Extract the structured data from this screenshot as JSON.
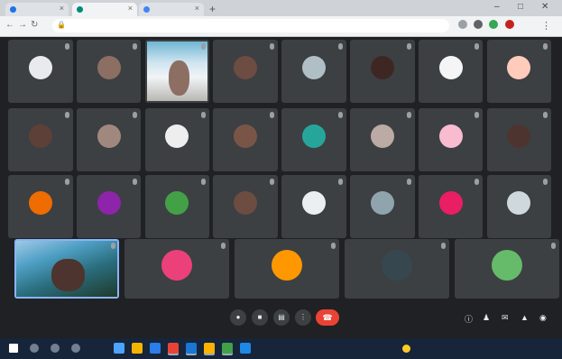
{
  "browser": {
    "tabs": [
      {
        "title": "",
        "active": false,
        "favicon_color": "#1a73e8"
      },
      {
        "title": "",
        "active": true,
        "favicon_color": "#00897b"
      },
      {
        "title": "",
        "active": false,
        "favicon_color": "#4285f4"
      }
    ],
    "new_tab_icon": "plus-icon",
    "url": "",
    "icons": [
      "back-icon",
      "forward-icon",
      "reload-icon",
      "lock-icon",
      "star-icon",
      "extension-icon",
      "profile-icon",
      "menu-icon"
    ]
  },
  "participants": [
    {
      "name": "",
      "avatar_color": "#e8eaed"
    },
    {
      "name": "",
      "avatar_color": "#8d6e63"
    },
    {
      "name": "",
      "avatar_color": "#d7ccc8",
      "video": true
    },
    {
      "name": "",
      "avatar_color": "#6d4c41"
    },
    {
      "name": "",
      "avatar_color": "#b0bec5"
    },
    {
      "name": "",
      "avatar_color": "#3e2723"
    },
    {
      "name": "",
      "avatar_color": "#f5f5f5"
    },
    {
      "name": "",
      "avatar_color": "#ffccbc"
    },
    {
      "name": "",
      "avatar_color": "#5d4037"
    },
    {
      "name": "",
      "avatar_color": "#a1887f"
    },
    {
      "name": "",
      "avatar_color": "#eeeeee"
    },
    {
      "name": "",
      "avatar_color": "#795548"
    },
    {
      "name": "",
      "avatar_color": "#26a69a"
    },
    {
      "name": "",
      "avatar_color": "#bcaaa4"
    },
    {
      "name": "",
      "avatar_color": "#f8bbd0"
    },
    {
      "name": "",
      "avatar_color": "#4e342e"
    },
    {
      "name": "",
      "avatar_color": "#ef6c00"
    },
    {
      "name": "",
      "avatar_color": "#8e24aa"
    },
    {
      "name": "",
      "avatar_color": "#43a047"
    },
    {
      "name": "",
      "avatar_color": "#6d4c41"
    },
    {
      "name": "",
      "avatar_color": "#eceff1"
    },
    {
      "name": "",
      "avatar_color": "#90a4ae"
    },
    {
      "name": "",
      "avatar_color": "#e91e63"
    },
    {
      "name": "",
      "avatar_color": "#cfd8dc"
    },
    {
      "name": "",
      "avatar_color": "#e0f2f1",
      "video": true,
      "speaking": true
    },
    {
      "name": "",
      "avatar_color": "#ec407a"
    },
    {
      "name": "",
      "avatar_color": "#ff9800"
    },
    {
      "name": "",
      "avatar_color": "#37474f"
    },
    {
      "name": "",
      "avatar_color": "#66bb6a"
    }
  ],
  "controls": {
    "meeting_info": "",
    "buttons": [
      "mic-icon",
      "camera-icon",
      "captions-icon",
      "more-icon"
    ],
    "leave_icon": "hang-up-icon",
    "right_icons": [
      "info-icon",
      "people-icon",
      "chat-icon",
      "activities-icon",
      "lock-icon"
    ]
  },
  "taskbar": {
    "apps": [
      {
        "color": "#ffffff",
        "icon": "windows-icon"
      },
      {
        "color": "#9aa7b8",
        "icon": "search-icon"
      },
      {
        "color": "#9aa7b8",
        "icon": "task-view-icon"
      },
      {
        "color": "#9aa7b8",
        "icon": "widgets-icon"
      },
      {
        "color": "#4da3ff",
        "icon": "edge-icon"
      },
      {
        "color": "#f4b400",
        "icon": "file-explorer-icon"
      },
      {
        "color": "#2b7de9",
        "icon": "store-icon"
      },
      {
        "color": "#ea4335",
        "icon": "chrome-icon"
      },
      {
        "color": "#1976d2",
        "icon": "word-icon"
      },
      {
        "color": "#ffb300",
        "icon": "folder-icon"
      },
      {
        "color": "#43a047",
        "icon": "meet-icon"
      },
      {
        "color": "#1e88e5",
        "icon": "app-icon"
      }
    ],
    "weather": "",
    "time": "",
    "date": ""
  }
}
